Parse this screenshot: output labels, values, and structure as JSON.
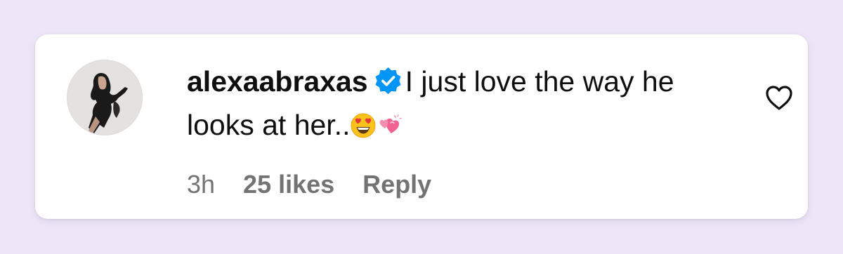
{
  "comment": {
    "username": "alexaabraxas",
    "text": "I just love the way he looks at her..",
    "emojis": [
      "smiling-face-with-heart-eyes",
      "revolving-hearts"
    ],
    "verified": true,
    "time": "3h",
    "likes": "25 likes",
    "reply_label": "Reply",
    "like_icon": "heart-outline-icon"
  },
  "colors": {
    "background": "#eee6f8",
    "card": "#ffffff",
    "text": "#0f0f0f",
    "meta_text": "#737373",
    "verified_badge": "#0095f6"
  }
}
